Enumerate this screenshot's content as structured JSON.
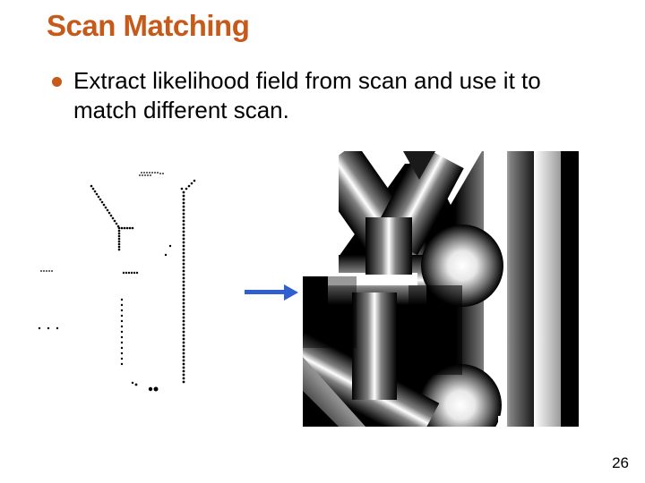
{
  "title": "Scan Matching",
  "bullet": "Extract likelihood field from scan and use it to match different scan.",
  "page_number": "26",
  "colors": {
    "title": "#c65a1a",
    "bullet_dot": "#c65a1a",
    "arrow": "#2f5fd0"
  },
  "figure": {
    "left_label": "raw-scan-point-cloud",
    "right_label": "likelihood-field",
    "arrow_label": "transform-arrow"
  }
}
